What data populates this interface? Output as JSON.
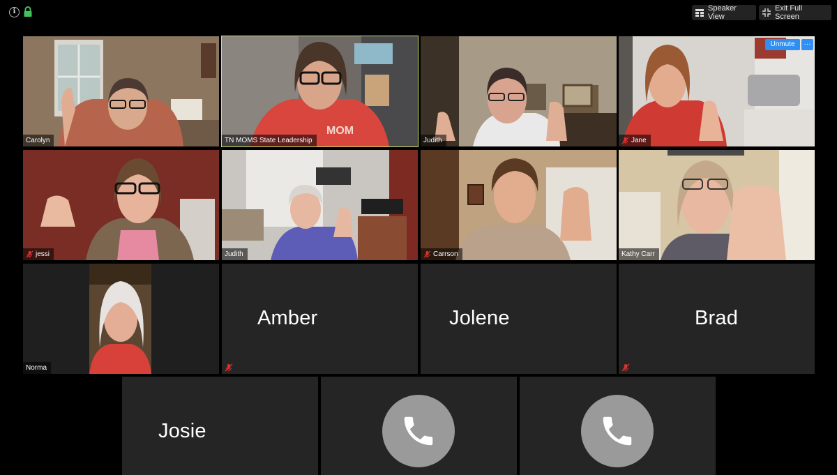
{
  "toolbar": {
    "speaker_view_label": "Speaker View",
    "exit_fullscreen_label": "Exit Full Screen",
    "icons": [
      "info-icon",
      "lock-icon",
      "grid-icon",
      "exit-fullscreen-icon"
    ],
    "lock_color": "#3fc25b"
  },
  "colors": {
    "active_speaker_outline": "#c9e46a",
    "tile_background": "#252525",
    "unmute_button": "#2f8ff3",
    "mute_icon": "#e0312f"
  },
  "participants": [
    {
      "name": "Carolyn",
      "video": true,
      "muted": false
    },
    {
      "name": "TN MOMS State Leadership",
      "video": true,
      "muted": false,
      "active_speaker": true
    },
    {
      "name": "Judith",
      "video": true,
      "muted": false
    },
    {
      "name": "Jane",
      "video": true,
      "muted": true,
      "tile_buttons": [
        "Unmute",
        "···"
      ]
    },
    {
      "name": "jessi",
      "video": true,
      "muted": true
    },
    {
      "name": "Judith",
      "video": true,
      "muted": false
    },
    {
      "name": "Carrson",
      "video": true,
      "muted": true
    },
    {
      "name": "Kathy Carr",
      "video": true,
      "muted": false
    },
    {
      "name": "Norma",
      "video": true,
      "muted": false
    },
    {
      "name": "Amber",
      "video": false,
      "muted": true
    },
    {
      "name": "Jolene",
      "video": false,
      "muted": false
    },
    {
      "name": "Brad",
      "video": false,
      "muted": true
    },
    {
      "name": "Josie",
      "video": false,
      "muted": false
    },
    {
      "name": "",
      "video": false,
      "phone": true
    },
    {
      "name": "",
      "video": false,
      "phone": true
    }
  ],
  "tile_buttons": {
    "unmute_label": "Unmute",
    "more_label": "···"
  }
}
